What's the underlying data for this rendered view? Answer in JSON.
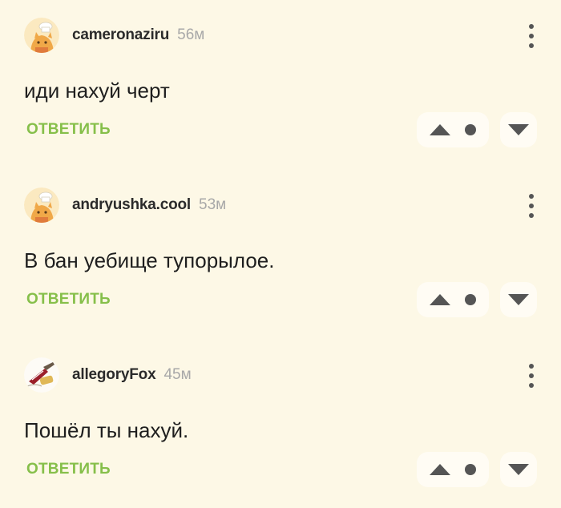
{
  "comments": [
    {
      "author": "cameronaziru",
      "time": "56м",
      "text": "иди нахуй черт",
      "reply_label": "ОТВЕТИТЬ",
      "avatar_icon": "chef-cat-avatar"
    },
    {
      "author": "andryushka.cool",
      "time": "53м",
      "text": "В бан уебище тупорылое.",
      "reply_label": "ОТВЕТИТЬ",
      "avatar_icon": "chef-cat-avatar"
    },
    {
      "author": "allegoryFox",
      "time": "45м",
      "text": "Пошёл ты нахуй.",
      "reply_label": "ОТВЕТИТЬ",
      "avatar_icon": "guitar-avatar"
    }
  ],
  "colors": {
    "background": "#fdf8e6",
    "reply": "#86bf4a",
    "time": "#a8a8a8",
    "button_bg": "#fffcf4",
    "icon": "#555555"
  }
}
